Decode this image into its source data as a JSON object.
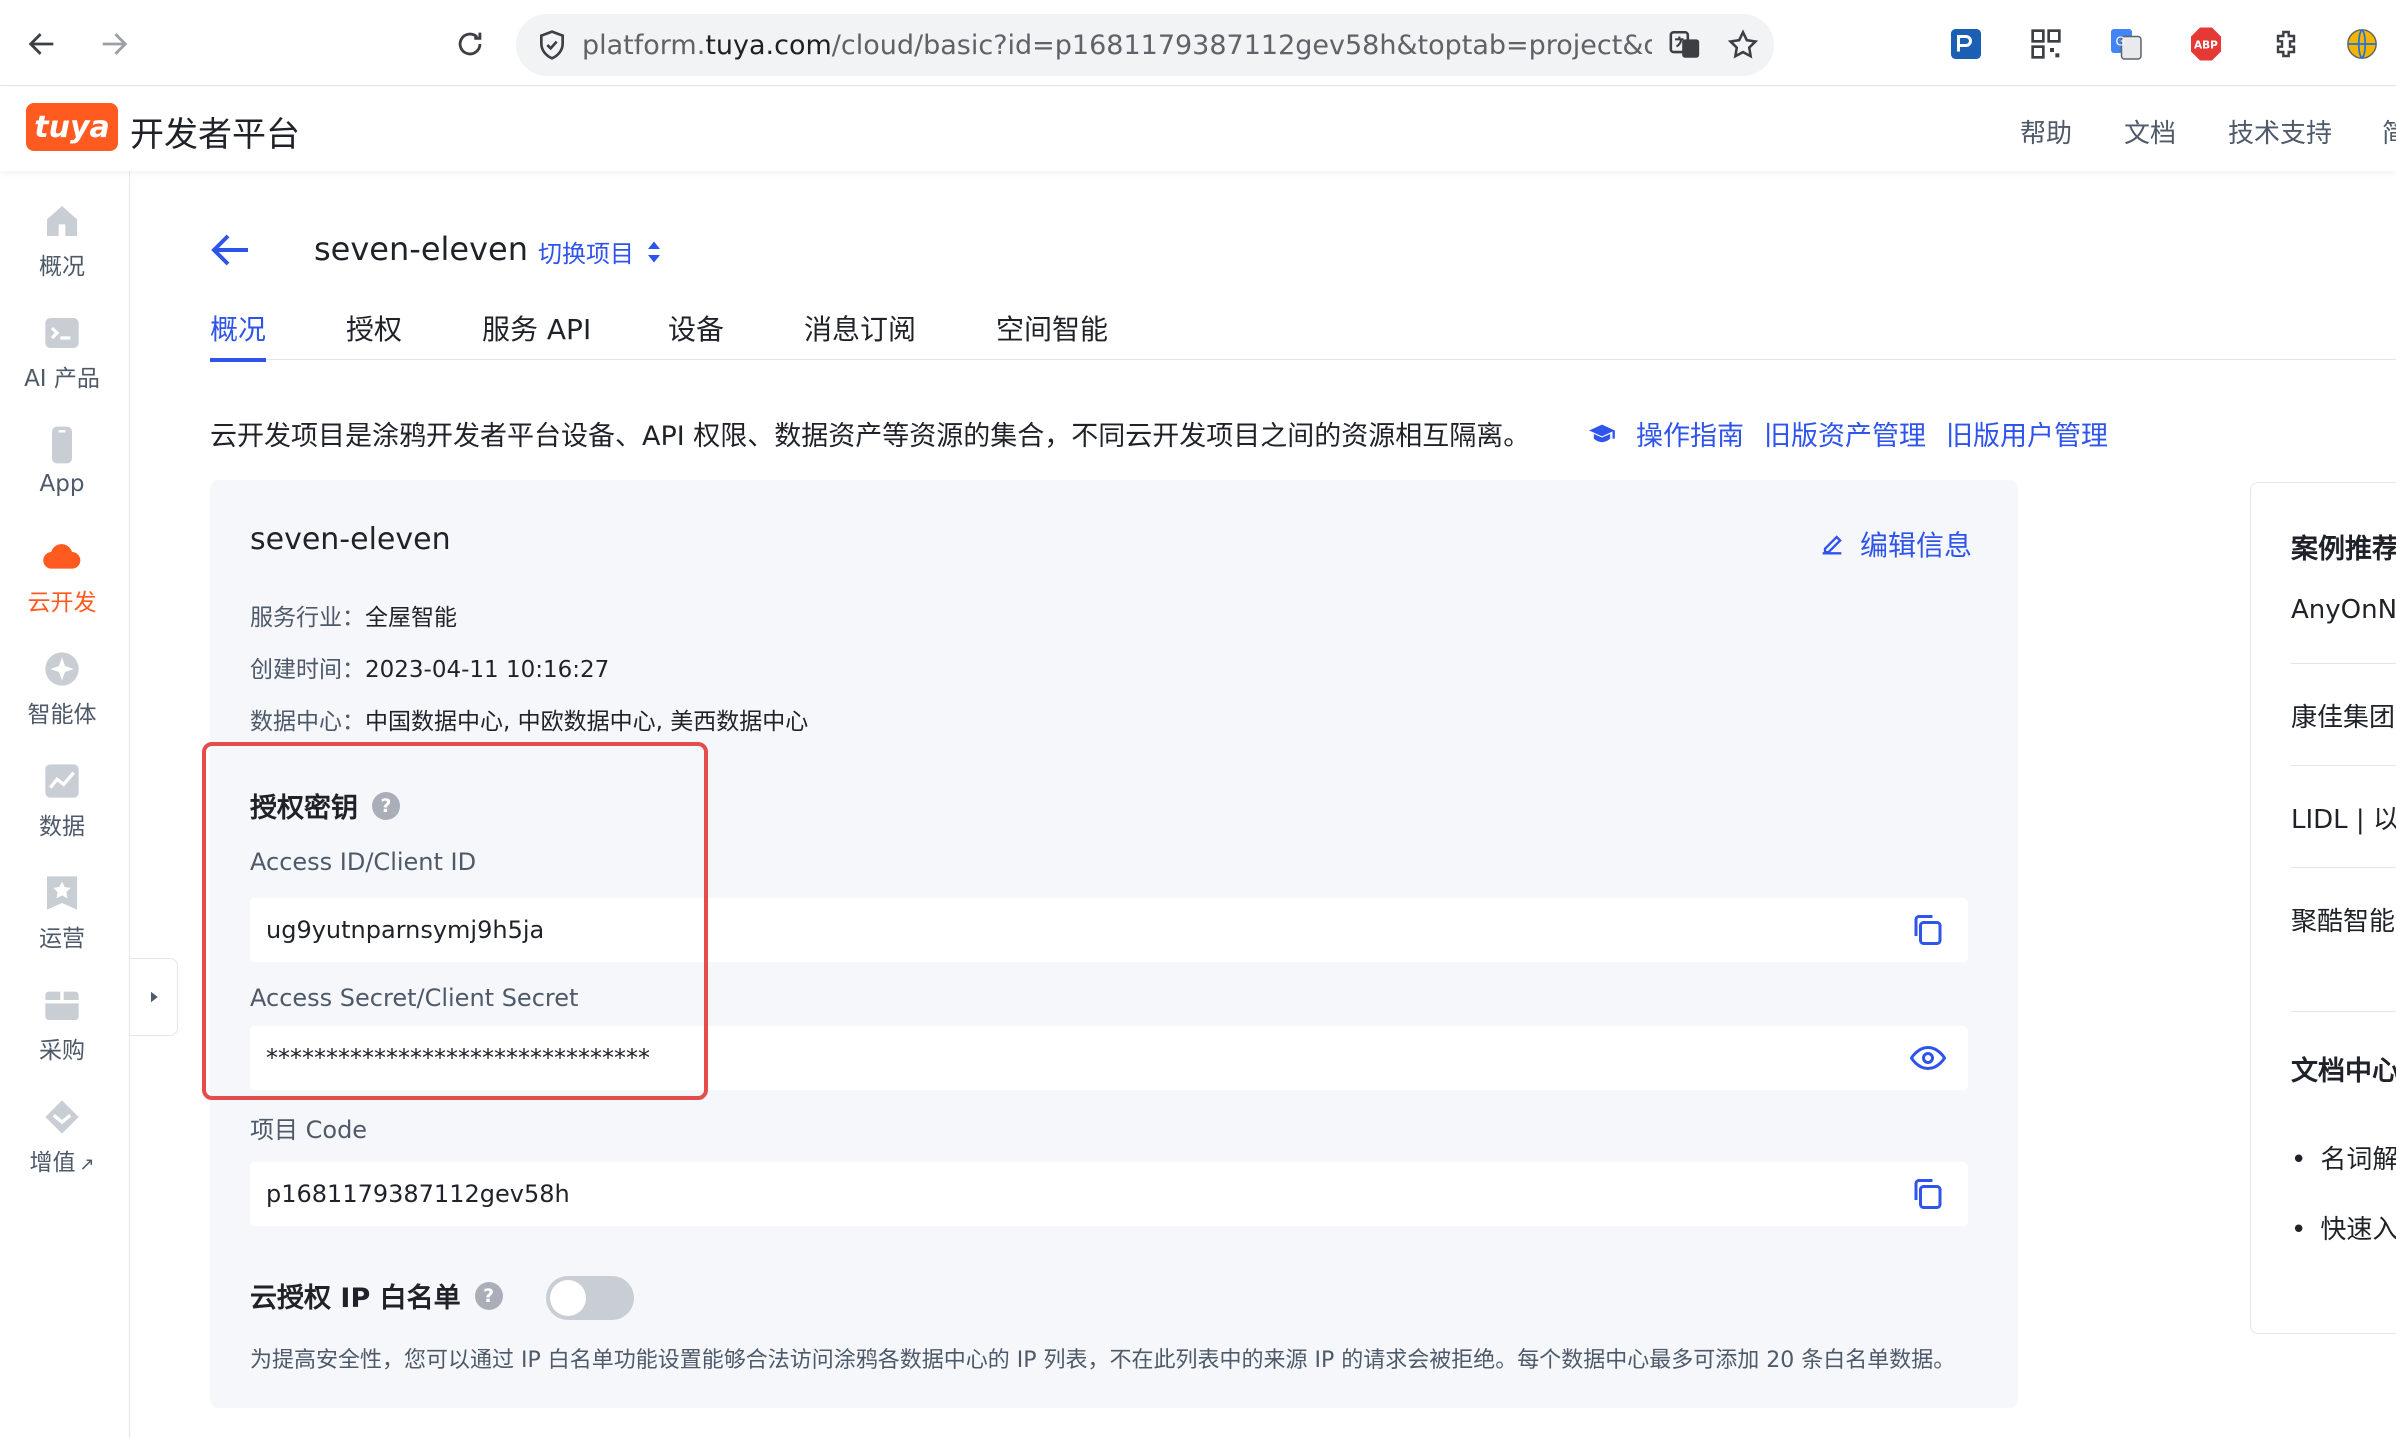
{
  "browser": {
    "url_prefix": "platform.",
    "url_domain": "tuya.com",
    "url_path": "/cloud/basic?id=p1681179387112gev58h&toptab=project&deviceT"
  },
  "header": {
    "logo_text": "tuya",
    "title": "开发者平台",
    "links": [
      "帮助",
      "文档",
      "技术支持",
      "简"
    ]
  },
  "sidebar": {
    "items": [
      {
        "label": "概况",
        "icon": "home-icon"
      },
      {
        "label": "AI 产品",
        "icon": "terminal-icon"
      },
      {
        "label": "App",
        "icon": "phone-icon"
      },
      {
        "label": "云开发",
        "icon": "cloud-icon",
        "active": true
      },
      {
        "label": "智能体",
        "icon": "sparkle-icon"
      },
      {
        "label": "数据",
        "icon": "chart-icon"
      },
      {
        "label": "运营",
        "icon": "star-badge-icon"
      },
      {
        "label": "采购",
        "icon": "box-icon"
      },
      {
        "label": "增值",
        "icon": "diamond-icon"
      }
    ],
    "external_mark": "↗"
  },
  "project": {
    "name": "seven-eleven",
    "switch_label": "切换项目"
  },
  "tabs": [
    "概况",
    "授权",
    "服务 API",
    "设备",
    "消息订阅",
    "空间智能"
  ],
  "intro": {
    "text": "云开发项目是涂鸦开发者平台设备、API 权限、数据资产等资源的集合，不同云开发项目之间的资源相互隔离。",
    "links": [
      "操作指南",
      "旧版资产管理",
      "旧版用户管理"
    ]
  },
  "card": {
    "title": "seven-eleven",
    "edit_label": "编辑信息",
    "industry_label": "服务行业：",
    "industry_value": "全屋智能",
    "created_label": "创建时间：",
    "created_value": "2023-04-11 10:16:27",
    "datacenter_label": "数据中心：",
    "datacenter_value": "中国数据中心, 中欧数据中心, 美西数据中心",
    "auth_title": "授权密钥",
    "help_glyph": "?",
    "access_id_label": "Access ID/Client ID",
    "access_id_value": "ug9yutnparnsymj9h5ja",
    "secret_label": "Access Secret/Client Secret",
    "secret_value": "********************************",
    "code_label": "项目 Code",
    "code_value": "p1681179387112gev58h",
    "whitelist_title": "云授权 IP 白名单",
    "whitelist_enabled": false,
    "whitelist_desc": "为提高安全性，您可以通过 IP 白名单功能设置能够合法访问涂鸦各数据中心的 IP 列表，不在此列表中的来源 IP 的请求会被拒绝。每个数据中心最多可添加 20 条白名单数据。"
  },
  "right_panel": {
    "cases_title": "案例推荐",
    "cases": [
      "AnyOnN",
      "康佳集团",
      "LIDL | 以",
      "聚酷智能"
    ],
    "docs_title": "文档中心",
    "docs": [
      "名词解",
      "快速入"
    ]
  },
  "colors": {
    "brand": "#ff5a1f",
    "accent": "#2f54eb",
    "highlight": "#e54c4c"
  }
}
